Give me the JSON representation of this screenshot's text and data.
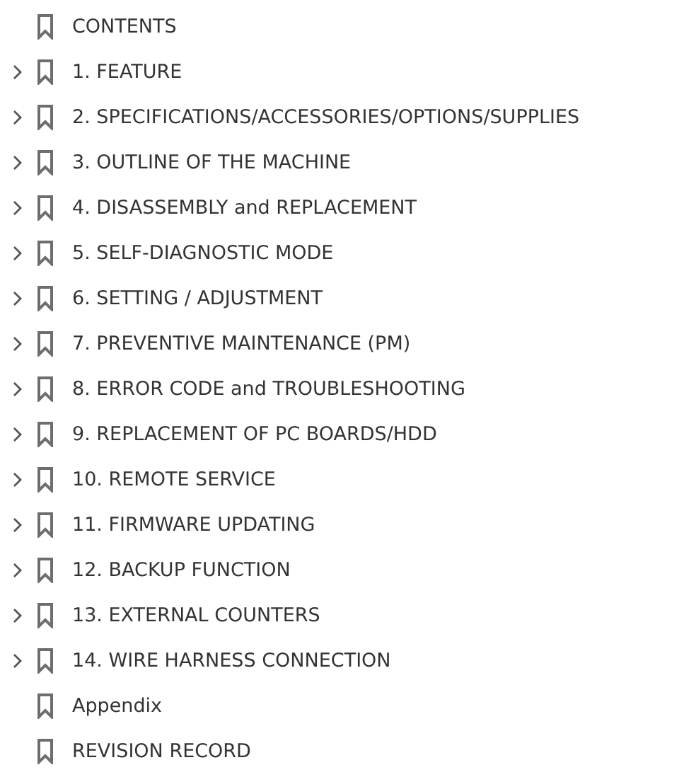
{
  "bookmarks": [
    {
      "label": "CONTENTS",
      "kind": "leaf"
    },
    {
      "label": "1. FEATURE",
      "kind": "branch",
      "expanded": false
    },
    {
      "label": "2. SPECIFICATIONS/ACCESSORIES/OPTIONS/SUPPLIES",
      "kind": "branch",
      "expanded": false
    },
    {
      "label": "3. OUTLINE OF THE MACHINE",
      "kind": "branch",
      "expanded": false
    },
    {
      "label": "4. DISASSEMBLY and REPLACEMENT",
      "kind": "branch",
      "expanded": false
    },
    {
      "label": "5. SELF-DIAGNOSTIC MODE",
      "kind": "branch",
      "expanded": false
    },
    {
      "label": "6. SETTING / ADJUSTMENT",
      "kind": "branch",
      "expanded": false
    },
    {
      "label": "7. PREVENTIVE MAINTENANCE (PM)",
      "kind": "branch",
      "expanded": false
    },
    {
      "label": "8. ERROR CODE and TROUBLESHOOTING",
      "kind": "branch",
      "expanded": false
    },
    {
      "label": "9. REPLACEMENT OF PC BOARDS/HDD",
      "kind": "branch",
      "expanded": false
    },
    {
      "label": "10. REMOTE SERVICE",
      "kind": "branch",
      "expanded": false
    },
    {
      "label": "11. FIRMWARE UPDATING",
      "kind": "branch",
      "expanded": false
    },
    {
      "label": "12. BACKUP FUNCTION",
      "kind": "branch",
      "expanded": false
    },
    {
      "label": "13. EXTERNAL COUNTERS",
      "kind": "branch",
      "expanded": false
    },
    {
      "label": "14. WIRE HARNESS CONNECTION",
      "kind": "branch",
      "expanded": false
    },
    {
      "label": "Appendix",
      "kind": "leaf"
    },
    {
      "label": "REVISION RECORD",
      "kind": "leaf"
    }
  ]
}
